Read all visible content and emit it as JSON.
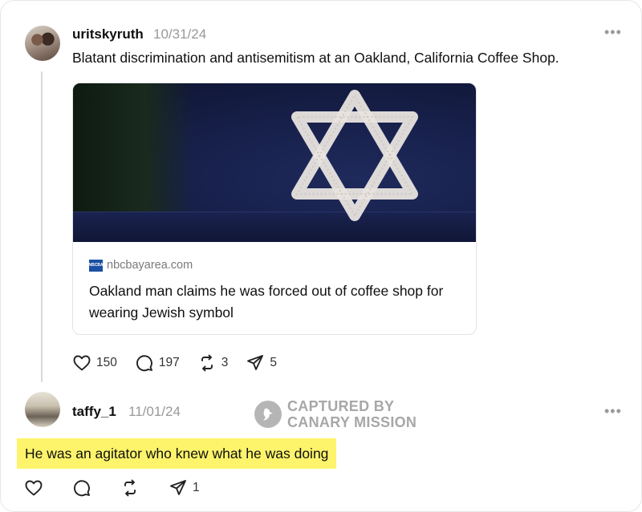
{
  "post": {
    "username": "uritskyruth",
    "timestamp": "10/31/24",
    "text": "Blatant discrimination and antisemitism at an Oakland, California Coffee Shop.",
    "more_label": "•••",
    "link_card": {
      "favicon_text": "NBCBA",
      "source": "nbcbayarea.com",
      "title": "Oakland man claims he was forced out of coffee shop for wearing Jewish symbol",
      "image_subject": "star-of-david-cap"
    },
    "actions": {
      "likes": "150",
      "comments": "197",
      "reposts": "3",
      "shares": "5"
    }
  },
  "reply": {
    "username": "taffy_1",
    "timestamp": "11/01/24",
    "text": "He was an agitator who knew what he was doing",
    "more_label": "•••",
    "actions": {
      "likes": "",
      "comments": "",
      "reposts": "",
      "shares": "1"
    },
    "highlight_color": "#fdf46b"
  },
  "watermark": {
    "line1": "CAPTURED BY",
    "line2": "CANARY MISSION"
  },
  "colors": {
    "text": "#101010",
    "muted": "#999999",
    "highlight": "#fdf46b",
    "star": "#e8e4df",
    "cap": "#17204a"
  }
}
